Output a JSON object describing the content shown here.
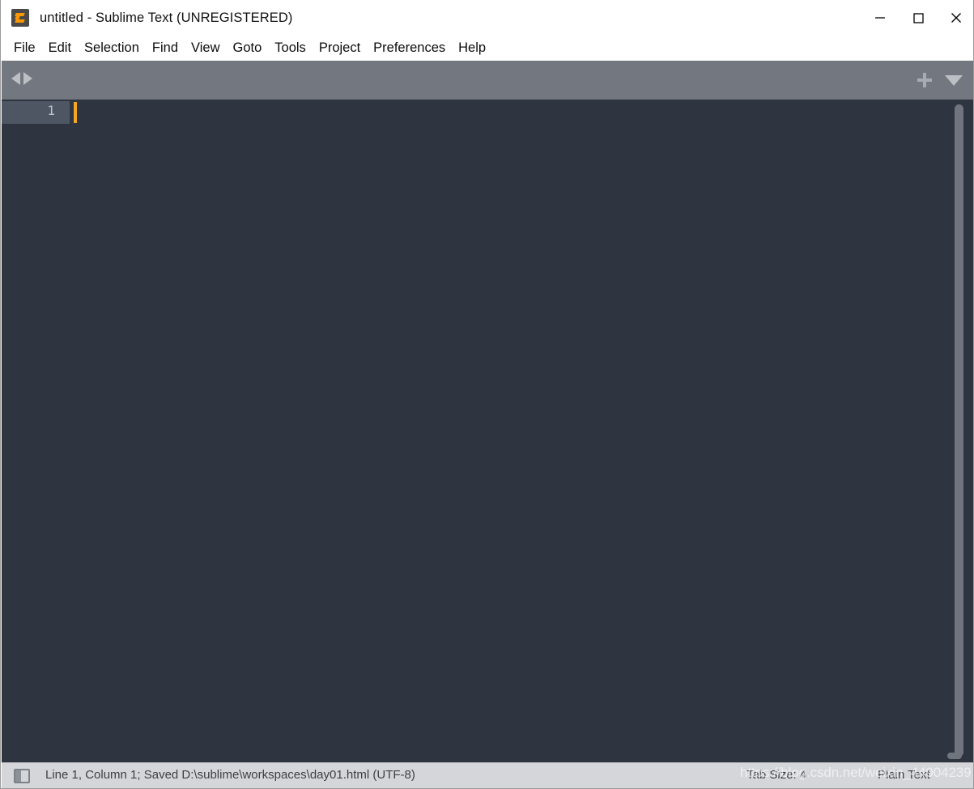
{
  "window": {
    "title": "untitled - Sublime Text (UNREGISTERED)",
    "logo_icon": "sublime-text-logo-icon",
    "controls": [
      {
        "name": "minimize",
        "icon": "minimize-icon",
        "label": "—"
      },
      {
        "name": "maximize",
        "icon": "maximize-icon",
        "label": "☐"
      },
      {
        "name": "close",
        "icon": "close-icon",
        "label": "✕"
      }
    ]
  },
  "menubar": {
    "items": [
      {
        "label": "File"
      },
      {
        "label": "Edit"
      },
      {
        "label": "Selection"
      },
      {
        "label": "Find"
      },
      {
        "label": "View"
      },
      {
        "label": "Goto"
      },
      {
        "label": "Tools"
      },
      {
        "label": "Project"
      },
      {
        "label": "Preferences"
      },
      {
        "label": "Help"
      }
    ]
  },
  "tabbar": {
    "nav_prev_icon": "triangle-left-icon",
    "nav_next_icon": "triangle-right-icon",
    "new_tab_icon": "plus-icon",
    "tab_menu_icon": "triangle-down-icon",
    "tabs": []
  },
  "editor": {
    "line_numbers": [
      "1"
    ],
    "content": "",
    "cursor_line": 1,
    "cursor_column": 1,
    "scrollbar_icon": "vertical-scrollbar"
  },
  "statusbar": {
    "sidebar_toggle_icon": "sidebar-toggle-icon",
    "position_and_file": "Line 1, Column 1; Saved D:\\sublime\\workspaces\\day01.html (UTF-8)",
    "tab_size": "Tab Size: 4",
    "syntax": "Plain Text"
  },
  "overlay": {
    "watermark": "https://blog.csdn.net/weixin_44904239"
  },
  "colors": {
    "titlebar_bg": "#ffffff",
    "menubar_bg": "#ffffff",
    "tabbar_bg": "#73777f",
    "editor_bg": "#2f3540",
    "gutter_active_bg": "#4d5662",
    "line_number_fg": "#b9c2d0",
    "cursor": "#f5a623",
    "statusbar_bg": "#d4d6d9",
    "statusbar_fg": "#3d3f42",
    "accent_orange": "#ff9800"
  }
}
